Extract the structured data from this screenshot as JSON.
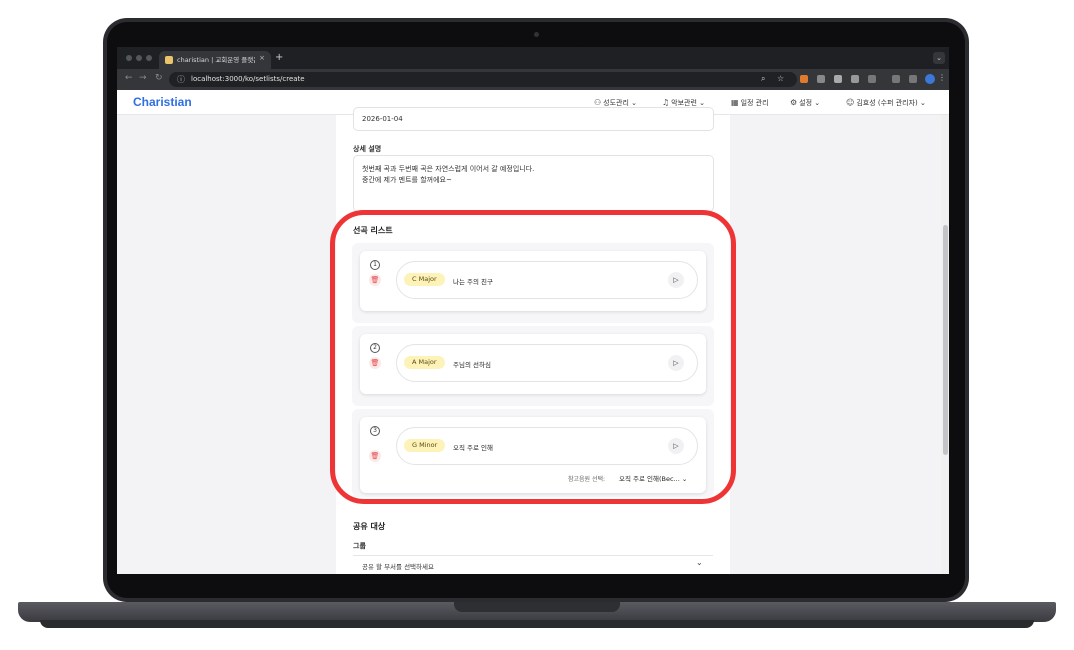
{
  "browser": {
    "tab_title": "charistian | 교회운영 플랫폼 플랫",
    "tab_close": "×",
    "new_tab": "+",
    "url": "localhost:3000/ko/setlists/create"
  },
  "app": {
    "logo": "Charistian",
    "nav": [
      {
        "label": "성도관리",
        "icon": "people-icon"
      },
      {
        "label": "악보관련",
        "icon": "sheet-music-icon"
      },
      {
        "label": "일정 관리",
        "icon": "calendar-icon"
      },
      {
        "label": "설정",
        "icon": "gear-icon"
      },
      {
        "label": "김효성 (수퍼 관리자)",
        "icon": "user-icon"
      }
    ]
  },
  "form": {
    "date_value": "2026-01-04",
    "description_label": "상세 설명",
    "description_lines": [
      "첫번째 곡과 두번째 곡은 자연스럽게 이어서 갈 예정입니다.",
      "중간에 제가 멘트를 할꺼에요~"
    ],
    "songs_title": "선곡 리스트",
    "songs": [
      {
        "number": "1",
        "key": "C Major",
        "title": "나는 주의 친구"
      },
      {
        "number": "2",
        "key": "A Major",
        "title": "주님의 선하심"
      },
      {
        "number": "3",
        "key": "G Minor",
        "title": "오직 주로 인해",
        "ref_label": "참고음원 선택:",
        "ref_value": "오직 주로 인해(Bec..."
      }
    ],
    "share_title": "공유 대상",
    "group_label": "그룹",
    "group_placeholder": "공유 할 부서를 선택하세요"
  },
  "colors": {
    "brand": "#2f6fe0",
    "highlight": "#ee3434",
    "key_chip": "#fdf3b8",
    "trash": "#e04848"
  }
}
